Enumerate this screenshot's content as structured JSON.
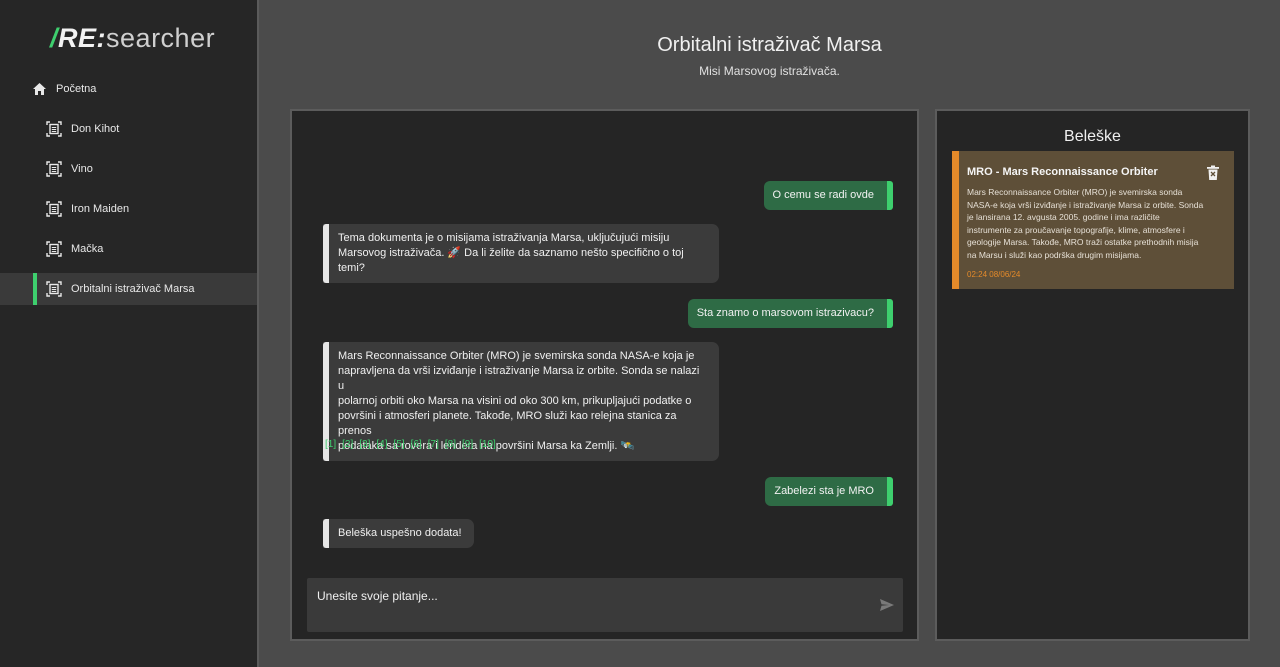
{
  "app": {
    "logo_re": "RE",
    "logo_colon": ":",
    "logo_rest": "searcher"
  },
  "sidebar": {
    "home_label": "Početna",
    "items": [
      {
        "label": "Don Kihot"
      },
      {
        "label": "Vino"
      },
      {
        "label": "Iron Maiden"
      },
      {
        "label": "Mačka"
      },
      {
        "label": "Orbitalni istraživač Marsa",
        "active": true
      }
    ]
  },
  "header": {
    "title": "Orbitalni istraživač Marsa",
    "subtitle": "Misi Marsovog istraživača."
  },
  "chat": {
    "messages": [
      {
        "role": "user",
        "text": "O cemu se radi ovde"
      },
      {
        "role": "bot",
        "line1": "Tema dokumenta je o misijama istraživanja Marsa, uključujući misiju",
        "line2": "Marsovog istraživača. 🚀 Da li želite da saznamo nešto specifično o toj temi?"
      },
      {
        "role": "user",
        "text": "Sta znamo o marsovom istrazivacu?"
      },
      {
        "role": "bot",
        "lines": [
          "Mars Reconnaissance Orbiter (MRO) je svemirska sonda NASA-e koja je",
          "napravljena da vrši izviđanje i istraživanje Marsa iz orbite. Sonda se nalazi u",
          "polarnoj orbiti oko Marsa na visini od oko 300 km, prikupljajući podatke o",
          "površini i atmosferi planete. Takođe, MRO služi kao relejna stanica za prenos",
          "podataka sa rovera i lendera na površini Marsa ka Zemlji. 🛰️"
        ]
      },
      {
        "role": "user",
        "text": "Zabelezi sta je MRO"
      },
      {
        "role": "bot",
        "text": "Beleška uspešno dodata!"
      }
    ],
    "references": [
      "[1]",
      "[2]",
      "[3]",
      "[4]",
      "[5]",
      "[6]",
      "[7]",
      "[8]",
      "[9]",
      "[10]"
    ],
    "input_placeholder": "Unesite svoje pitanje..."
  },
  "notes": {
    "title": "Beleške",
    "items": [
      {
        "title": "MRO - Mars Reconnaissance Orbiter",
        "body_lines": [
          "Mars Reconnaissance Orbiter (MRO) je svemirska sonda",
          "NASA-e koja vrši izviđanje i istraživanje Marsa iz orbite. Sonda",
          "je lansirana 12. avgusta 2005. godine i ima različite",
          "instrumente za proučavanje topografije, klime, atmosfere i",
          "geologije Marsa. Takođe, MRO traži ostatke prethodnih misija",
          "na Marsu i služi kao podrška drugim misijama."
        ],
        "timestamp": "02:24 08/06/24"
      }
    ]
  },
  "colors": {
    "accent_green": "#3ecf6e",
    "user_bubble": "#2e6b45",
    "note_accent": "#e48a2a",
    "note_bg": "#5e4f38"
  },
  "icons": {
    "home": "home-icon",
    "document": "document-scan-icon",
    "send": "send-icon",
    "trash": "trash-icon"
  }
}
